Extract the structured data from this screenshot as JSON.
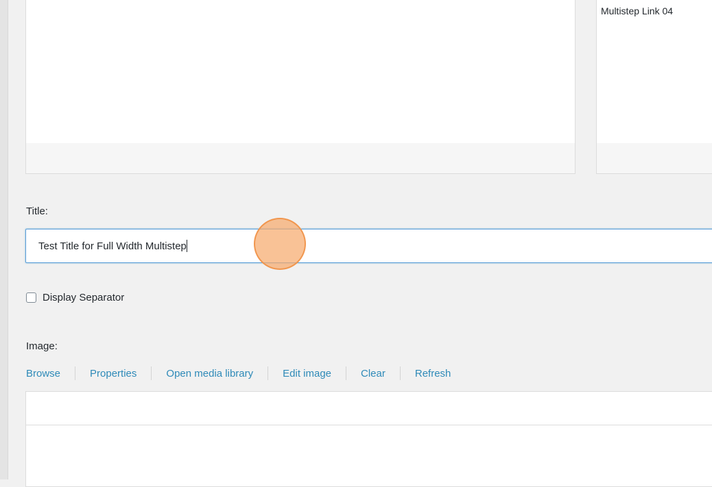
{
  "top_right_panel": {
    "link_label": "Multistep Link 04"
  },
  "title_field": {
    "label": "Title:",
    "value": "Test Title for Full Width Multistep"
  },
  "separator": {
    "label": "Display Separator",
    "checked": false
  },
  "image_field": {
    "label": "Image:",
    "toolbar": {
      "browse": "Browse",
      "properties": "Properties",
      "open_media_library": "Open media library",
      "edit_image": "Edit image",
      "clear": "Clear",
      "refresh": "Refresh"
    }
  },
  "colors": {
    "link": "#2e8ab8",
    "focus_border": "#5b9dd9",
    "click_marker": "#f6aa6e",
    "background": "#f1f1f1"
  }
}
